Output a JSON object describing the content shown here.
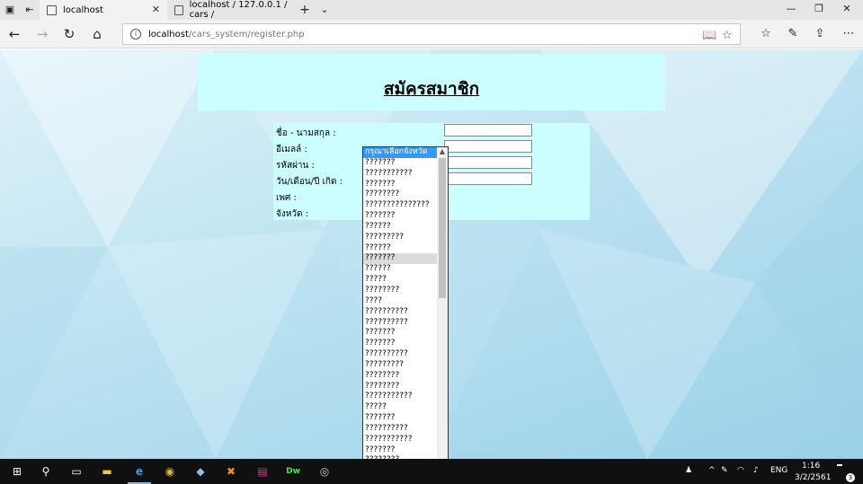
{
  "browser": {
    "tabs": [
      {
        "label": "localhost",
        "active": true
      },
      {
        "label": "localhost / 127.0.0.1 / cars /",
        "active": false
      }
    ],
    "new_tab_icon": "plus-icon",
    "address": {
      "host": "localhost",
      "path": "/cars_system/register.php"
    }
  },
  "page": {
    "title": "สมัครสมาชิก",
    "form_labels": {
      "name": "ชื่อ - นามสกุล :",
      "email": "อีเมลล์ :",
      "password": "รหัสผ่าน :",
      "birthdate": "วัน/เดือน/ปี เกิด :",
      "gender": "เพศ :",
      "province": "จังหวัด :"
    },
    "dropdown": {
      "options": [
        "กรุณาเลือกจังหวัด",
        "???????",
        "???????????",
        "???????",
        "????????",
        "???????????????",
        "???????",
        "??????",
        "?????????",
        "??????",
        "???????",
        "??????",
        "?????",
        "????????",
        "????",
        "??????????",
        "??????????",
        "???????",
        "???????",
        "??????????",
        "?????????",
        "????????",
        "????????",
        "???????????",
        "?????",
        "???????",
        "??????????",
        "???????????",
        "???????",
        "????????",
        "???",
        "???????",
        "?????????"
      ],
      "selected_index": 0,
      "hover_index": 10
    }
  },
  "taskbar": {
    "language": "ENG",
    "time": "1:16",
    "date": "3/2/2561",
    "notification_count": "3"
  },
  "colors": {
    "header_bg": "#ccfdff",
    "selected_option": "#3399ff",
    "taskbar": "#101010"
  }
}
